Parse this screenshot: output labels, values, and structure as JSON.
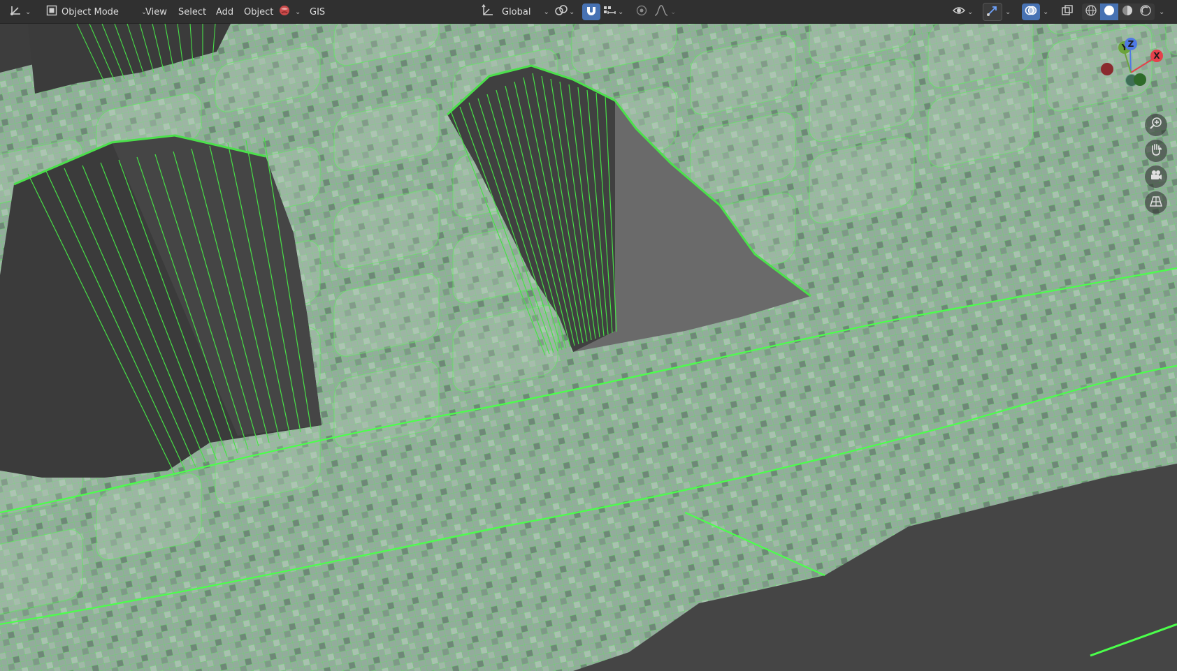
{
  "header": {
    "editor_type_icon": "3d-viewport-icon",
    "mode": {
      "label": "Object Mode",
      "icon": "object-mode-icon"
    },
    "menus": [
      "View",
      "Select",
      "Add",
      "Object",
      "GIS"
    ],
    "transform_orientation": "Global",
    "icons": {
      "pivot": "pivot-point-icon",
      "snap": "snap-magnet-icon",
      "snap_target": "snap-increment-icon",
      "proportional": "proportional-edit-icon",
      "falloff": "falloff-curve-icon",
      "visibility": "eye-icon",
      "gizmo": "gizmo-toggle-icon",
      "overlays": "overlays-icon",
      "xray": "xray-toggle-icon",
      "shading": [
        "wireframe-shading-icon",
        "solid-shading-icon",
        "material-preview-icon",
        "rendered-shading-icon"
      ]
    },
    "active_shading": "solid"
  },
  "gizmo": {
    "axes": {
      "x": "X",
      "y": "Y",
      "z": "Z"
    },
    "colors": {
      "x": "#e5414b",
      "y": "#6ba33a",
      "z": "#4f79e5",
      "neg_x": "#8a2a2e",
      "neg_y": "#2f6b2a"
    },
    "nav_buttons": [
      "zoom-icon",
      "pan-hand-icon",
      "camera-view-icon",
      "ortho-grid-icon"
    ]
  },
  "viewport": {
    "background": "#3d3d3d",
    "wire_color": "#4be04b",
    "mesh_face_color": "#8ea89a",
    "overlay": "wireframe"
  }
}
